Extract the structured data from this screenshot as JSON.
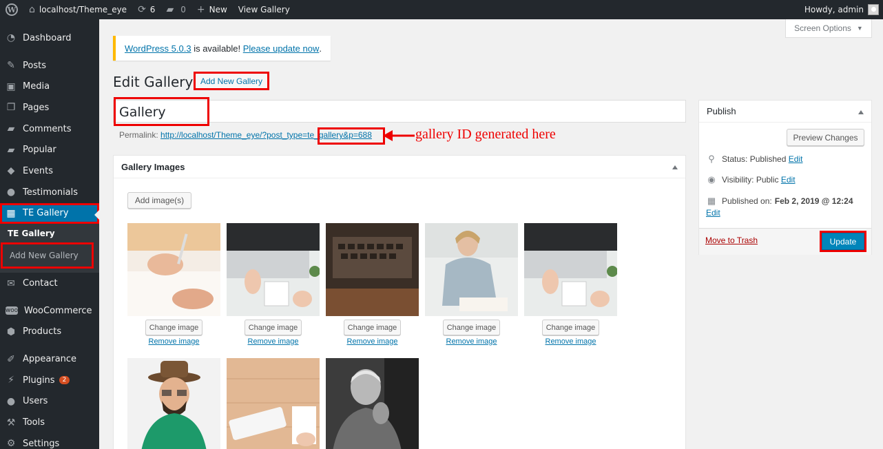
{
  "admin_bar": {
    "site_name": "localhost/Theme_eye",
    "updates_count": "6",
    "comments_count": "0",
    "new_label": "New",
    "view_label": "View Gallery",
    "howdy": "Howdy, admin"
  },
  "sidebar": {
    "items": [
      {
        "name": "dashboard",
        "label": "Dashboard",
        "icon": "dashboard-icon"
      },
      {
        "name": "posts",
        "label": "Posts",
        "icon": "pin-icon"
      },
      {
        "name": "media",
        "label": "Media",
        "icon": "media-icon"
      },
      {
        "name": "pages",
        "label": "Pages",
        "icon": "pages-icon"
      },
      {
        "name": "comments",
        "label": "Comments",
        "icon": "comment-icon"
      },
      {
        "name": "popular",
        "label": "Popular",
        "icon": "comment-icon"
      },
      {
        "name": "events",
        "label": "Events",
        "icon": "tag-icon"
      },
      {
        "name": "testimonials",
        "label": "Testimonials",
        "icon": "user-icon"
      },
      {
        "name": "te-gallery",
        "label": "TE Gallery",
        "icon": "gallery-icon"
      },
      {
        "name": "contact",
        "label": "Contact",
        "icon": "mail-icon"
      },
      {
        "name": "woocommerce",
        "label": "WooCommerce",
        "icon": "woo-icon"
      },
      {
        "name": "products",
        "label": "Products",
        "icon": "box-icon"
      },
      {
        "name": "appearance",
        "label": "Appearance",
        "icon": "brush-icon"
      },
      {
        "name": "plugins",
        "label": "Plugins",
        "icon": "plug-icon",
        "badge": "2"
      },
      {
        "name": "users",
        "label": "Users",
        "icon": "user-icon"
      },
      {
        "name": "tools",
        "label": "Tools",
        "icon": "wrench-icon"
      },
      {
        "name": "settings",
        "label": "Settings",
        "icon": "settings-icon"
      }
    ],
    "submenu": {
      "title": "TE Gallery",
      "add_new": "Add New Gallery"
    }
  },
  "screen_options": "Screen Options",
  "notice": {
    "link1": "WordPress 5.0.3",
    "middle": " is available! ",
    "link2": "Please update now",
    "end": "."
  },
  "page_title": "Edit Gallery",
  "add_new_button": "Add New Gallery",
  "post_title": "Gallery",
  "permalink": {
    "label": "Permalink:",
    "url": "http://localhost/Theme_eye/?post_type=te_gallery&p=688"
  },
  "annotation": "gallery ID generated here",
  "gallery_box": {
    "title": "Gallery Images",
    "add_images": "Add image(s)",
    "change_label": "Change image",
    "remove_label": "Remove image"
  },
  "publish": {
    "title": "Publish",
    "preview": "Preview Changes",
    "status_label": "Status:",
    "status_value": "Published",
    "visibility_label": "Visibility:",
    "visibility_value": "Public",
    "published_label": "Published on:",
    "published_value": "Feb 2, 2019 @ 12:24",
    "edit": "Edit",
    "trash": "Move to Trash",
    "update": "Update"
  }
}
